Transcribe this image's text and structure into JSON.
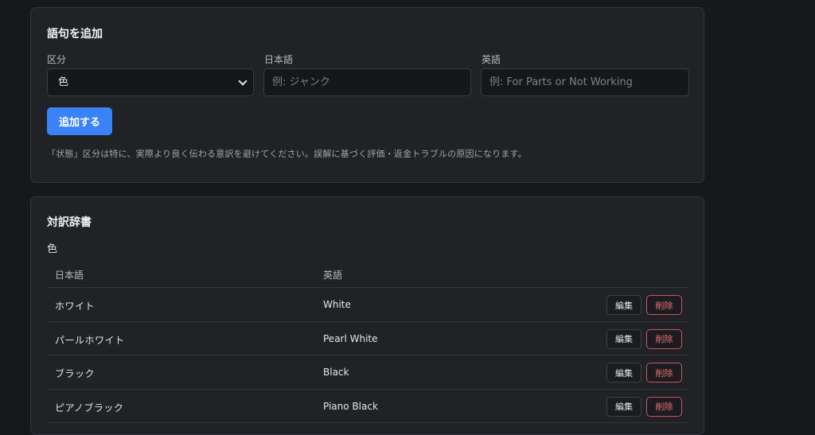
{
  "add_section": {
    "title": "語句を追加",
    "category_label": "区分",
    "category_value": "色",
    "category_options": [
      "色"
    ],
    "japanese_label": "日本語",
    "japanese_placeholder": "例: ジャンク",
    "english_label": "英語",
    "english_placeholder": "例: For Parts or Not Working",
    "add_button": "追加する",
    "note": "「状態」区分は特に、実際より良く伝わる意訳を避けてください。誤解に基づく評価・返金トラブルの原因になります。"
  },
  "dictionary": {
    "title": "対訳辞書",
    "group_label": "色",
    "headers": {
      "japanese": "日本語",
      "english": "英語"
    },
    "edit_label": "編集",
    "delete_label": "削除",
    "rows": [
      {
        "ja": "ホワイト",
        "en": "White"
      },
      {
        "ja": "パールホワイト",
        "en": "Pearl White"
      },
      {
        "ja": "ブラック",
        "en": "Black"
      },
      {
        "ja": "ピアノブラック",
        "en": "Piano Black"
      }
    ]
  },
  "colors": {
    "background": "#17181b",
    "card": "#202226",
    "accent": "#3b82f6",
    "danger": "#ef6b72"
  }
}
